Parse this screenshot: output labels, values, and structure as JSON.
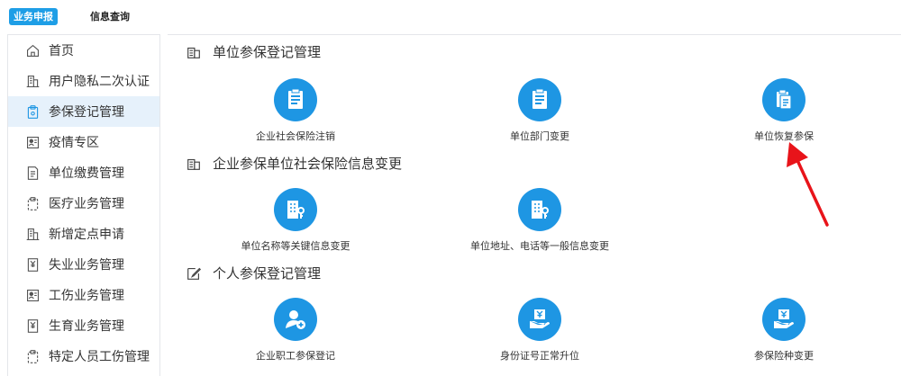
{
  "top_tabs": {
    "active": "业务申报",
    "other": "信息查询"
  },
  "sidebar": {
    "items": [
      {
        "label": "首页",
        "icon": "home-icon"
      },
      {
        "label": "用户隐私二次认证",
        "icon": "building-icon"
      },
      {
        "label": "参保登记管理",
        "icon": "clipboard-icon"
      },
      {
        "label": "疫情专区",
        "icon": "id-card-icon"
      },
      {
        "label": "单位缴费管理",
        "icon": "document-icon"
      },
      {
        "label": "医疗业务管理",
        "icon": "clipboard-icon"
      },
      {
        "label": "新增定点申请",
        "icon": "building-icon"
      },
      {
        "label": "失业业务管理",
        "icon": "yen-document-icon"
      },
      {
        "label": "工伤业务管理",
        "icon": "id-card-icon"
      },
      {
        "label": "生育业务管理",
        "icon": "yen-document-icon"
      },
      {
        "label": "特定人员工伤管理",
        "icon": "clipboard-icon"
      }
    ],
    "active_index": 2
  },
  "sections": [
    {
      "title": "单位参保登记管理",
      "tiles": [
        {
          "label": "企业社会保险注销",
          "icon": "document-list-icon"
        },
        {
          "label": "单位部门变更",
          "icon": "document-list-icon"
        },
        {
          "label": "单位恢复参保",
          "icon": "clipboard-copy-icon"
        }
      ]
    },
    {
      "title": "企业参保单位社会保险信息变更",
      "tiles": [
        {
          "label": "单位名称等关键信息变更",
          "icon": "building-key-icon"
        },
        {
          "label": "单位地址、电话等一般信息变更",
          "icon": "building-key-icon"
        }
      ]
    },
    {
      "title": "个人参保登记管理",
      "tiles": [
        {
          "label": "企业职工参保登记",
          "icon": "user-add-icon"
        },
        {
          "label": "身份证号正常升位",
          "icon": "yen-hand-icon"
        },
        {
          "label": "参保险种变更",
          "icon": "yen-hand-icon"
        }
      ]
    }
  ],
  "colors": {
    "accent": "#1e96e3",
    "active_tab": "#1e9ee6",
    "sidebar_active": "#e6f1fb",
    "annotation_arrow": "#e8141a"
  }
}
